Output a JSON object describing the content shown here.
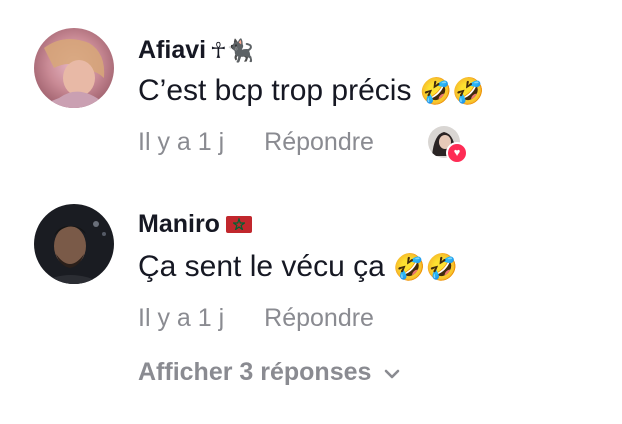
{
  "comments": [
    {
      "username": "Afiavi",
      "username_decoration": "☥🐈‍⬛",
      "text": "C’est bcp trop précis",
      "emoji": "🤣🤣",
      "time": "Il y a 1 j",
      "reply_label": "Répondre"
    },
    {
      "username": "Maniro",
      "text": "Ça sent le vécu ça",
      "emoji": "🤣🤣",
      "time": "Il y a 1 j",
      "reply_label": "Répondre"
    }
  ],
  "view_replies_label": "Afficher 3 réponses",
  "colors": {
    "text": "#161823",
    "secondary": "#8a8b91",
    "like_badge": "#fe2c55",
    "flag_red": "#c1272d",
    "flag_star": "#006233"
  },
  "icons": {
    "flag": "morocco-flag-icon",
    "liked_by": "heart-icon",
    "expand": "chevron-down-icon"
  }
}
